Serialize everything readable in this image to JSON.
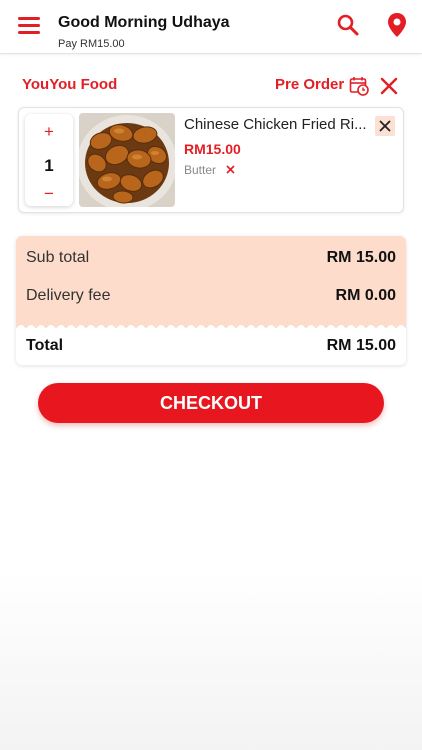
{
  "header": {
    "greeting": "Good Morning Udhaya",
    "pay_text": "Pay RM15.00",
    "icons": [
      "menu-icon",
      "search-icon",
      "location-pin-icon"
    ]
  },
  "cart": {
    "restaurant": "YouYou Food",
    "pre_order_label": "Pre Order",
    "items": [
      {
        "name": "Chinese Chicken Fried Ri...",
        "price": "RM15.00",
        "quantity": "1",
        "addon": "Butter",
        "image": "fried-plantain-chips-photo"
      }
    ]
  },
  "summary": {
    "subtotal_label": "Sub total",
    "subtotal_value": "RM 15.00",
    "delivery_label": "Delivery fee",
    "delivery_value": "RM 0.00",
    "total_label": "Total",
    "total_value": "RM 15.00"
  },
  "checkout_label": "CHECKOUT",
  "colors": {
    "accent": "#e31e24",
    "summary_bg": "#fddccb",
    "remove_bg": "#fde0d4"
  }
}
